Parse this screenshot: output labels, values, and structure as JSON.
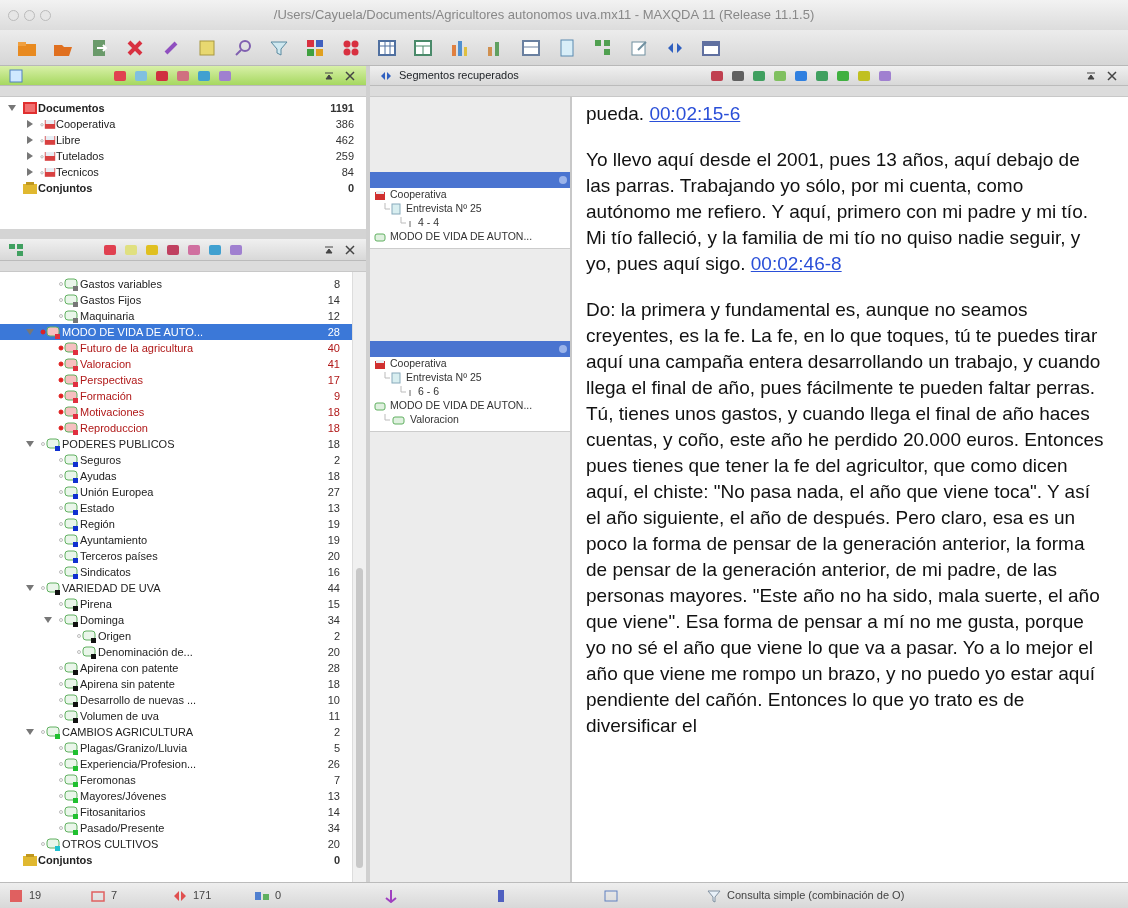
{
  "window": {
    "title": "/Users/Cayuela/Documents/Agricultores autonomos uva.mx11 - MAXQDA 11 (Release 11.1.5)"
  },
  "document_tree": [
    {
      "kind": "root",
      "label": "Documentos",
      "count": "1191",
      "expanded": true,
      "children": [
        {
          "kind": "group",
          "label": "Cooperativa",
          "count": "386",
          "expanded": false
        },
        {
          "kind": "group",
          "label": "Libre",
          "count": "462",
          "expanded": false
        },
        {
          "kind": "group",
          "label": "Tutelados",
          "count": "259",
          "expanded": false
        },
        {
          "kind": "group",
          "label": "Tecnicos",
          "count": "84",
          "expanded": false
        }
      ]
    },
    {
      "kind": "set",
      "label": "Conjuntos",
      "count": "0"
    }
  ],
  "code_tree": [
    {
      "kind": "continued",
      "children": [
        {
          "kind": "continued",
          "children": [
            {
              "kind": "code",
              "label": "Gastos variables",
              "count": "8",
              "color": "#777777",
              "activated": false,
              "selected": false
            },
            {
              "kind": "code",
              "label": "Gastos Fijos",
              "count": "14",
              "color": "#777777",
              "activated": false,
              "selected": false
            },
            {
              "kind": "code",
              "label": "Maquinaria",
              "count": "12",
              "color": "#777777",
              "activated": false,
              "selected": false
            }
          ]
        },
        {
          "kind": "code",
          "label": "MODO DE VIDA DE AUTO...",
          "count": "28",
          "color": "#e03040",
          "activated": true,
          "selected": true,
          "expanded": true,
          "children": [
            {
              "kind": "code",
              "label": "Futuro de la agricultura",
              "count": "40",
              "color": "#e03040",
              "activated": true,
              "selected": false
            },
            {
              "kind": "code",
              "label": "Valoracion",
              "count": "41",
              "color": "#e03040",
              "activated": true,
              "selected": false
            },
            {
              "kind": "code",
              "label": "Perspectivas",
              "count": "17",
              "color": "#e03040",
              "activated": true,
              "selected": false
            },
            {
              "kind": "code",
              "label": "Formación",
              "count": "9",
              "color": "#e03040",
              "activated": true,
              "selected": false
            },
            {
              "kind": "code",
              "label": "Motivaciones",
              "count": "18",
              "color": "#e03040",
              "activated": true,
              "selected": false
            },
            {
              "kind": "code",
              "label": "Reproduccion",
              "count": "18",
              "color": "#e03040",
              "activated": true,
              "selected": false
            }
          ]
        },
        {
          "kind": "code",
          "label": "PODERES PUBLICOS",
          "count": "18",
          "color": "#1030d0",
          "activated": false,
          "selected": false,
          "expanded": true,
          "children": [
            {
              "kind": "code",
              "label": "Seguros",
              "count": "2",
              "color": "#1030d0",
              "activated": false,
              "selected": false
            },
            {
              "kind": "code",
              "label": "Ayudas",
              "count": "18",
              "color": "#1030d0",
              "activated": false,
              "selected": false
            },
            {
              "kind": "code",
              "label": "Unión Europea",
              "count": "27",
              "color": "#1030d0",
              "activated": false,
              "selected": false
            },
            {
              "kind": "code",
              "label": "Estado",
              "count": "13",
              "color": "#1030d0",
              "activated": false,
              "selected": false
            },
            {
              "kind": "code",
              "label": "Región",
              "count": "19",
              "color": "#1030d0",
              "activated": false,
              "selected": false
            },
            {
              "kind": "code",
              "label": "Ayuntamiento",
              "count": "19",
              "color": "#1030d0",
              "activated": false,
              "selected": false
            },
            {
              "kind": "code",
              "label": "Terceros países",
              "count": "20",
              "color": "#1030d0",
              "activated": false,
              "selected": false
            },
            {
              "kind": "code",
              "label": "Sindicatos",
              "count": "16",
              "color": "#1030d0",
              "activated": false,
              "selected": false
            }
          ]
        },
        {
          "kind": "code",
          "label": "VARIEDAD DE UVA",
          "count": "44",
          "color": "#111111",
          "activated": false,
          "selected": false,
          "expanded": true,
          "children": [
            {
              "kind": "code",
              "label": "Pirena",
              "count": "15",
              "color": "#111111",
              "activated": false,
              "selected": false
            },
            {
              "kind": "code",
              "label": "Dominga",
              "count": "34",
              "color": "#111111",
              "activated": false,
              "selected": false,
              "expanded": true,
              "children": [
                {
                  "kind": "code",
                  "label": "Origen",
                  "count": "2",
                  "color": "#111111",
                  "activated": false,
                  "selected": false
                },
                {
                  "kind": "code",
                  "label": "Denominación de...",
                  "count": "20",
                  "color": "#111111",
                  "activated": false,
                  "selected": false
                }
              ]
            },
            {
              "kind": "code",
              "label": "Apirena con patente",
              "count": "28",
              "color": "#111111",
              "activated": false,
              "selected": false
            },
            {
              "kind": "code",
              "label": "Apirena sin patente",
              "count": "18",
              "color": "#111111",
              "activated": false,
              "selected": false
            },
            {
              "kind": "code",
              "label": "Desarrollo de nuevas ...",
              "count": "10",
              "color": "#111111",
              "activated": false,
              "selected": false
            },
            {
              "kind": "code",
              "label": "Volumen de uva",
              "count": "11",
              "color": "#111111",
              "activated": false,
              "selected": false
            }
          ]
        },
        {
          "kind": "code",
          "label": "CAMBIOS AGRICULTURA",
          "count": "2",
          "color": "#20c030",
          "activated": false,
          "selected": false,
          "expanded": true,
          "children": [
            {
              "kind": "code",
              "label": "Plagas/Granizo/Lluvia",
              "count": "5",
              "color": "#20c030",
              "activated": false,
              "selected": false
            },
            {
              "kind": "code",
              "label": "Experiencia/Profesion...",
              "count": "26",
              "color": "#20c030",
              "activated": false,
              "selected": false
            },
            {
              "kind": "code",
              "label": "Feromonas",
              "count": "7",
              "color": "#20c030",
              "activated": false,
              "selected": false
            },
            {
              "kind": "code",
              "label": "Mayores/Jóvenes",
              "count": "13",
              "color": "#20c030",
              "activated": false,
              "selected": false
            },
            {
              "kind": "code",
              "label": "Fitosanitarios",
              "count": "14",
              "color": "#20c030",
              "activated": false,
              "selected": false
            },
            {
              "kind": "code",
              "label": "Pasado/Presente",
              "count": "34",
              "color": "#20c030",
              "activated": false,
              "selected": false
            }
          ]
        },
        {
          "kind": "code",
          "label": "OTROS CULTIVOS",
          "count": "20",
          "color": "#20c0d0",
          "activated": false,
          "selected": false
        }
      ]
    },
    {
      "kind": "set",
      "label": "Conjuntos",
      "count": "0"
    }
  ],
  "retrieved": {
    "title": "Segmentos recuperados",
    "segments": [
      {
        "lines": [
          {
            "kind": "group",
            "text": "Cooperativa"
          },
          {
            "kind": "document",
            "text": "Entrevista Nº 25"
          },
          {
            "kind": "range",
            "text": "4 - 4"
          },
          {
            "kind": "code",
            "text": "MODO DE VIDA DE AUTON..."
          }
        ]
      },
      {
        "lines": [
          {
            "kind": "group",
            "text": "Cooperativa"
          },
          {
            "kind": "document",
            "text": "Entrevista Nº 25"
          },
          {
            "kind": "range",
            "text": "6 - 6"
          },
          {
            "kind": "code",
            "text": "MODO DE VIDA DE AUTON..."
          },
          {
            "kind": "subcode",
            "text": "Valoracion"
          }
        ]
      }
    ],
    "paragraphs": [
      {
        "text": "pueda.",
        "timestamp": "00:02:15-6"
      },
      {
        "text": "Yo llevo aquí desde el 2001, pues 13 años, aquí debajo de las parras. Trabajando yo sólo, por mi cuenta, como autónomo me refiero. Y aquí, primero con mi padre y mi tío. Mi tío falleció, y la familia de mi tío no quiso nadie seguir, y yo, pues aquí sigo.",
        "timestamp": "00:02:46-8"
      },
      {
        "text": "Do: la primera y fundamental es, aunque no seamos creyentes, es la fe. La fe, en lo que toques, tú te puedes tirar aquí una campaña entera desarrollando un trabajo, y cuando llega el final de año, pues fácilmente te pueden faltar perras. Tú, tienes unos gastos, y cuando llega el final de año haces cuentas, y coño, este año he perdido 20.000 euros. Entonces pues tienes que tener la fe del agricultor, que como dicen aquí, el chiste: \"No pasa nada, el año que viene toca\". Y así el año siguiente, el año de después. Pero claro, esa es un poco la forma de pensar de la generación anterior, la forma de pensar de la generación anterior, de mi padre, de las personas mayores. \"Este año no ha sido, mala suerte, el año que viene\". Esa forma de pensar a mí no me gusta, porque yo no sé el año que viene lo que va a pasar. Yo a lo mejor el año que viene me rompo un brazo, y no puedo yo estar aquí pendiente del cañón. Entonces lo que yo trato es de diversificar el"
      }
    ]
  },
  "status_bar": {
    "counts": [
      {
        "kind": "documents",
        "text": "19"
      },
      {
        "kind": "memos",
        "text": "7"
      },
      {
        "kind": "codes",
        "text": "171"
      },
      {
        "kind": "variables",
        "text": "0"
      }
    ],
    "query": "Consulta simple (combinación de O)"
  }
}
